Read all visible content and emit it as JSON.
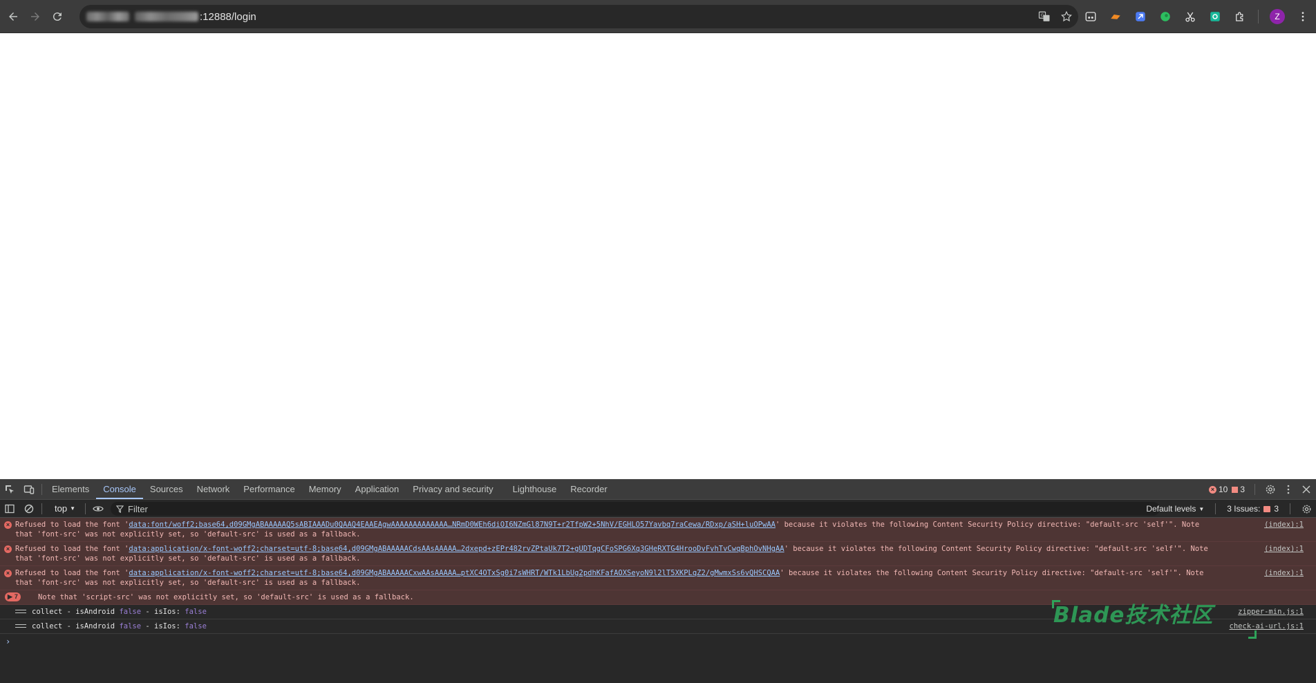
{
  "browser": {
    "url_suffix": ":12888/login",
    "avatar_letter": "Z",
    "extensions": [
      "ext-dark-reader-icon",
      "ext-orange-icon",
      "ext-blue-icon",
      "ext-evernote-icon",
      "ext-scissors-icon",
      "ext-green-icon",
      "extensions-puzzle-icon"
    ]
  },
  "devtools": {
    "tabs": [
      "Elements",
      "Console",
      "Sources",
      "Network",
      "Performance",
      "Memory",
      "Application",
      "Privacy and security",
      "Lighthouse",
      "Recorder"
    ],
    "active_tab": "Console",
    "error_count": "10",
    "warning_count": "3",
    "context": "top",
    "filter_placeholder": "Filter",
    "levels": "Default levels",
    "issues_label": "3 Issues:",
    "issues_count": "3"
  },
  "console": {
    "errors": [
      {
        "prefix": "Refused to load the font '",
        "link": "data:font/woff2;base64,d09GMgABAAAAAQ5sABIAAADu0QAAQ4EAAEAgwAAAAAAAAAAAAA…NRmD0WEh6diOI6NZmGl87N9T+r2TfpW2+5NhV/EGHLO57Yavbq7raCewa/RDxp/aSH+luOPwAA",
        "suffix": "' because it violates the following Content Security Policy directive: \"default-src 'self'\". Note that 'font-src' was not explicitly set, so 'default-src' is used as a fallback.",
        "source": "(index):1"
      },
      {
        "prefix": "Refused to load the font '",
        "link": "data:application/x-font-woff2;charset=utf-8;base64,d09GMgABAAAAACdsAAsAAAAA…2dxepd+zEPr482rvZPtaUk7T2+gUDTqgCFoSPG6Xq3GHeRXTG4HrooDvFvhTvCwqBphOvNHgAA",
        "suffix": "' because it violates the following Content Security Policy directive: \"default-src 'self'\". Note that 'font-src' was not explicitly set, so 'default-src' is used as a fallback.",
        "source": "(index):1"
      },
      {
        "prefix": "Refused to load the font '",
        "link": "data:application/x-font-woff2;charset=utf-8;base64,d09GMgABAAAAACxwAAsAAAAA…ptXC4OTxSg0i7sWHRT/WTk1LbUg2pdhKFafAOXSeyoN9l2lT5XKPLqZ2/gMwmxSs6vQHSCQAA",
        "suffix": "' because it violates the following Content Security Policy directive: \"default-src 'self'\". Note that 'font-src' was not explicitly set, so 'default-src' is used as a fallback.",
        "source": "(index):1"
      }
    ],
    "group": {
      "count": "7",
      "text": "Note that 'script-src' was not explicitly set, so 'default-src' is used as a fallback."
    },
    "logs": [
      {
        "text1": "collect - isAndroid",
        "v1": "false",
        "text2": " - isIos:",
        "v2": "false",
        "source": "zipper-min.js:1"
      },
      {
        "text1": "collect - isAndroid",
        "v1": "false",
        "text2": " - isIos:",
        "v2": "false",
        "source": "check-ai-url.js:1"
      }
    ],
    "prompt": "›"
  },
  "watermark": "Blade技术社区"
}
